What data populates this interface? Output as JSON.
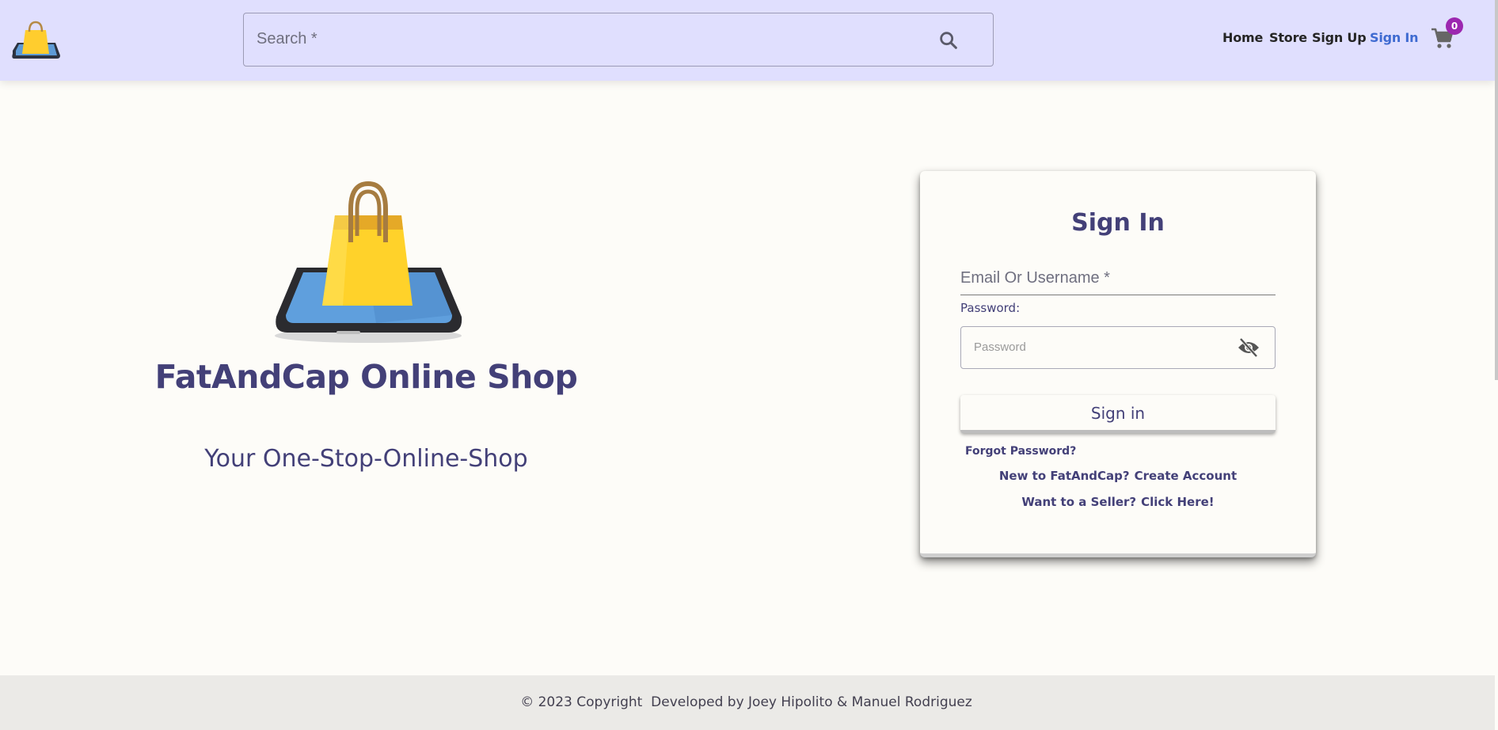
{
  "header": {
    "search": {
      "placeholder": "Search *"
    },
    "nav": [
      {
        "label": "Home"
      },
      {
        "label": "Store"
      },
      {
        "label": "Sign Up"
      },
      {
        "label": "Sign In",
        "active": true
      }
    ],
    "cart": {
      "count": "0",
      "icon": "cart-icon"
    },
    "accent_color": "#e0dffe",
    "active_link_color": "#3f6bd1",
    "badge_color": "#9c27b0"
  },
  "hero": {
    "title": "FatAndCap Online Shop",
    "subtitle": "Your One-Stop-Online-Shop",
    "logo_icon": "shopping-bag-on-tablet-logo"
  },
  "signin": {
    "title": "Sign In",
    "email_label": "Email Or Username *",
    "password_label": "Password:",
    "password_placeholder": "Password",
    "button_label": "Sign in",
    "forgot": "Forgot Password?",
    "new_prompt": "New to FatAndCap?",
    "create_link": "Create Account",
    "seller_prompt": "Want to a Seller?",
    "seller_link": "Click Here!"
  },
  "footer": {
    "text": "© 2023 Copyright  Developed by Joey Hipolito & Manuel Rodriguez"
  },
  "brand_text_color": "#434078"
}
